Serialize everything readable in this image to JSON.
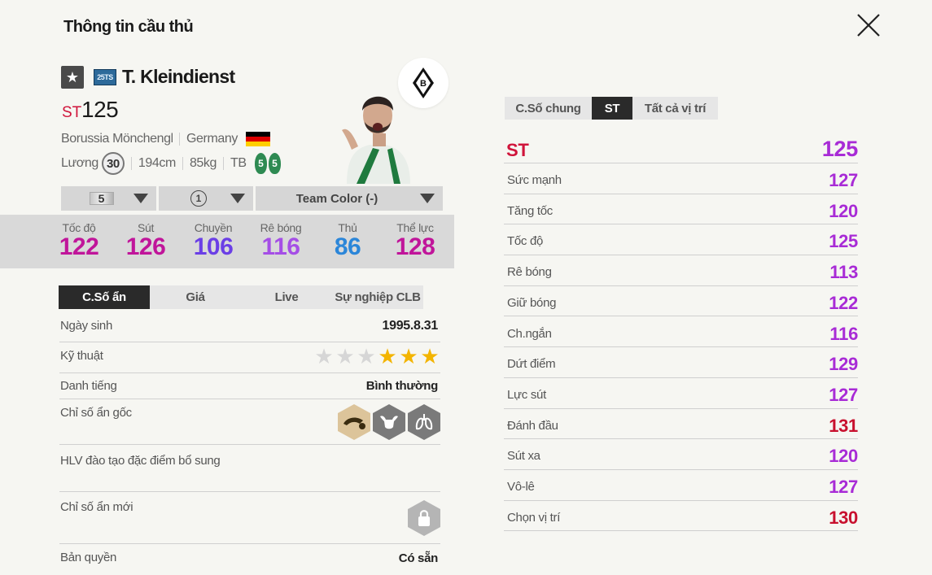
{
  "header": {
    "title": "Thông tin cầu thủ"
  },
  "player": {
    "season_badge": "25TS",
    "name": "T. Kleindienst",
    "position": "ST",
    "ovr": "125",
    "club": "Borussia Mönchengladbach",
    "nation": "Germany",
    "pay_label": "Lương",
    "pay": "30",
    "height": "194cm",
    "weight": "85kg",
    "body_type": "TB",
    "left_foot": "5",
    "right_foot": "5"
  },
  "selectors": {
    "grade": "5",
    "upgrade": "1",
    "team_color": "Team Color (-)"
  },
  "main_stats": [
    {
      "label": "Tốc độ",
      "value": "122",
      "color": "#c0159a"
    },
    {
      "label": "Sút",
      "value": "126",
      "color": "#c0159a"
    },
    {
      "label": "Chuyền",
      "value": "106",
      "color": "#6b3fe6"
    },
    {
      "label": "Rê bóng",
      "value": "116",
      "color": "#a54ee6"
    },
    {
      "label": "Thủ",
      "value": "86",
      "color": "#2b86d9"
    },
    {
      "label": "Thể lực",
      "value": "128",
      "color": "#c0159a"
    }
  ],
  "left_tabs": [
    "C.Số ẩn",
    "Giá",
    "Live",
    "Sự nghiệp CLB"
  ],
  "details": {
    "birth_label": "Ngày sinh",
    "birth": "1995.8.31",
    "skill_label": "Kỹ thuật",
    "skill_stars": 3,
    "skill_max": 6,
    "fame_label": "Danh tiếng",
    "fame": "Bình thường",
    "traits_label": "Chỉ số ẩn gốc",
    "coach_label": "HLV đào tạo đặc điểm bổ sung",
    "new_traits_label": "Chỉ số ẩn mới",
    "license_label": "Bản quyền",
    "license": "Có sẵn"
  },
  "icons": {
    "close": "close-icon",
    "star": "star-icon",
    "lock": "lock-icon"
  },
  "right_tabs": [
    "C.Số chung",
    "ST",
    "Tất cả vị trí"
  ],
  "position_stats": {
    "head_label": "ST",
    "head_value": "125",
    "rows": [
      {
        "label": "Sức mạnh",
        "value": "127",
        "color": "#a82bd6"
      },
      {
        "label": "Tăng tốc",
        "value": "120",
        "color": "#a82bd6"
      },
      {
        "label": "Tốc độ",
        "value": "125",
        "color": "#a82bd6"
      },
      {
        "label": "Rê bóng",
        "value": "113",
        "color": "#a82bd6"
      },
      {
        "label": "Giữ bóng",
        "value": "122",
        "color": "#a82bd6"
      },
      {
        "label": "Ch.ngắn",
        "value": "116",
        "color": "#a82bd6"
      },
      {
        "label": "Dứt điểm",
        "value": "129",
        "color": "#a82bd6"
      },
      {
        "label": "Lực sút",
        "value": "127",
        "color": "#a82bd6"
      },
      {
        "label": "Đánh đầu",
        "value": "131",
        "color": "#c8102e"
      },
      {
        "label": "Sút xa",
        "value": "120",
        "color": "#a82bd6"
      },
      {
        "label": "Vô-lê",
        "value": "127",
        "color": "#a82bd6"
      },
      {
        "label": "Chọn vị trí",
        "value": "130",
        "color": "#c8102e"
      }
    ]
  }
}
